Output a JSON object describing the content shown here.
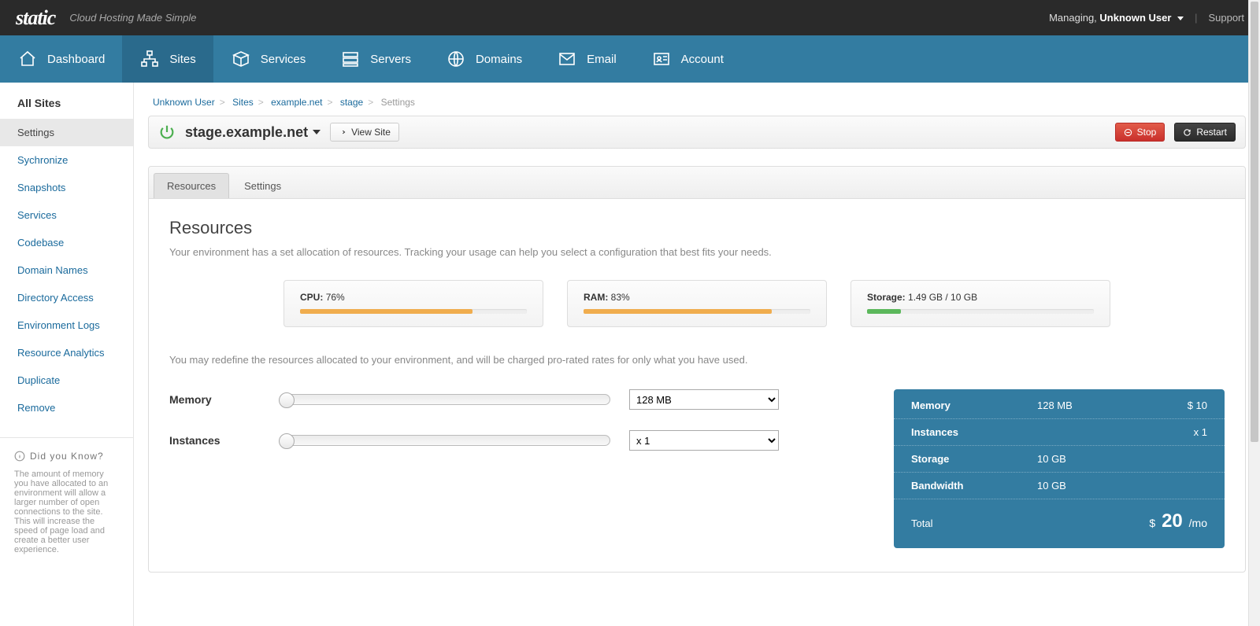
{
  "topbar": {
    "brand": "static",
    "tagline": "Cloud Hosting Made Simple",
    "managing_prefix": "Managing,",
    "user": "Unknown User",
    "support": "Support"
  },
  "nav": {
    "dashboard": "Dashboard",
    "sites": "Sites",
    "services": "Services",
    "servers": "Servers",
    "domains": "Domains",
    "email": "Email",
    "account": "Account"
  },
  "sidebar": {
    "heading": "All Sites",
    "items": [
      "Settings",
      "Sychronize",
      "Snapshots",
      "Services",
      "Codebase",
      "Domain Names",
      "Directory Access",
      "Environment Logs",
      "Resource Analytics",
      "Duplicate",
      "Remove"
    ],
    "tip_title": "Did you Know?",
    "tip_body": "The amount of memory you have allocated to an environment will allow a larger number of open connections to the site. This will increase the speed of page load and create a better user experience."
  },
  "breadcrumb": {
    "user": "Unknown User",
    "sites": "Sites",
    "site": "example.net",
    "env": "stage",
    "current": "Settings"
  },
  "site_header": {
    "title": "stage.example.net",
    "view_site": "View Site",
    "stop": "Stop",
    "restart": "Restart"
  },
  "tabs": {
    "resources": "Resources",
    "settings": "Settings"
  },
  "resources": {
    "heading": "Resources",
    "lead": "Your environment has a set allocation of resources. Tracking your usage can help you select a configuration that best fits your needs.",
    "cpu_label": "CPU:",
    "cpu_value": "76%",
    "cpu_pct": 76,
    "ram_label": "RAM:",
    "ram_value": "83%",
    "ram_pct": 83,
    "storage_label": "Storage:",
    "storage_value": "1.49 GB / 10 GB",
    "storage_pct": 15,
    "note": "You may redefine the resources allocated to your environment, and will be charged pro-rated rates for only what you have used.",
    "memory_label": "Memory",
    "memory_value": "128 MB",
    "instances_label": "Instances",
    "instances_value": "x 1"
  },
  "pricing": {
    "memory_k": "Memory",
    "memory_v": "128 MB",
    "memory_c": "$ 10",
    "instances_k": "Instances",
    "instances_v": "",
    "instances_c": "x 1",
    "storage_k": "Storage",
    "storage_v": "10 GB",
    "storage_c": "",
    "bandwidth_k": "Bandwidth",
    "bandwidth_v": "10 GB",
    "bandwidth_c": "",
    "total_k": "Total",
    "total_prefix": "$",
    "total_amount": "20",
    "total_suffix": "/mo"
  }
}
